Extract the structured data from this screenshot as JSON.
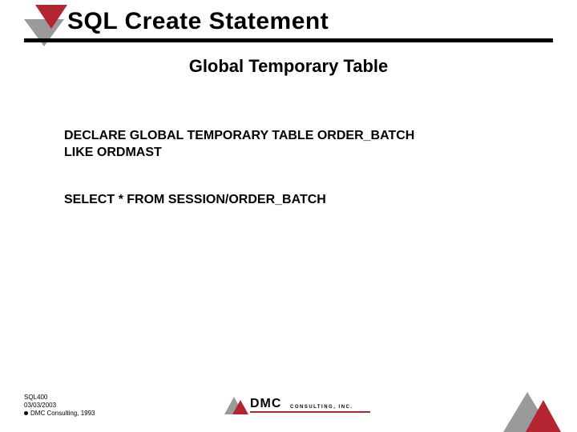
{
  "header": {
    "title": "SQL Create Statement",
    "subtitle": "Global Temporary Table"
  },
  "code": {
    "block1": "DECLARE GLOBAL TEMPORARY TABLE ORDER_BATCH\nLIKE ORDMAST",
    "block2": "SELECT * FROM SESSION/ORDER_BATCH"
  },
  "footer": {
    "course": "SQL400",
    "date": "03/03/2003",
    "copyright": "DMC Consulting, 1993",
    "logo_text": "DMC",
    "logo_sub": "CONSULTING, INC."
  },
  "colors": {
    "accent_red": "#b22531",
    "accent_gray": "#9a9a9a"
  }
}
